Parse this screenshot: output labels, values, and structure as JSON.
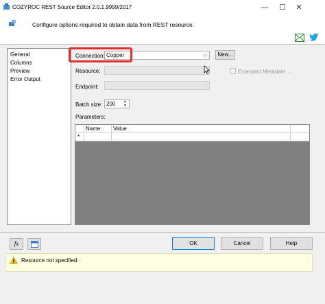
{
  "window": {
    "title": "COZYROC REST Source Editor 2.0.1.9999/2017",
    "minimize": "—",
    "maximize": "☐",
    "close": "✕"
  },
  "header": {
    "description": "Configure options required to obtain data from REST resource."
  },
  "nav": {
    "items": [
      "General",
      "Columns",
      "Preview",
      "Error Output"
    ]
  },
  "form": {
    "connection_label": "Connection:",
    "connection_value": "Copper",
    "new_button": "New...",
    "resource_label": "Resource:",
    "extended_metadata_label": "Extended Metadata ...",
    "endpoint_label": "Endpoint:",
    "batch_size_label": "Batch size:",
    "batch_size_value": "200",
    "parameters_label": "Parameters:"
  },
  "parameters_table": {
    "columns": [
      "Name",
      "Value"
    ],
    "new_row_marker": "*"
  },
  "footer": {
    "fx_button": "fx",
    "ok_button": "OK",
    "cancel_button": "Cancel",
    "help_button": "Help"
  },
  "status": {
    "message": "Resource not specified."
  },
  "colors": {
    "highlight_box": "#e03030",
    "warning_bg": "#ffffe1",
    "grid_bg": "#808080"
  }
}
